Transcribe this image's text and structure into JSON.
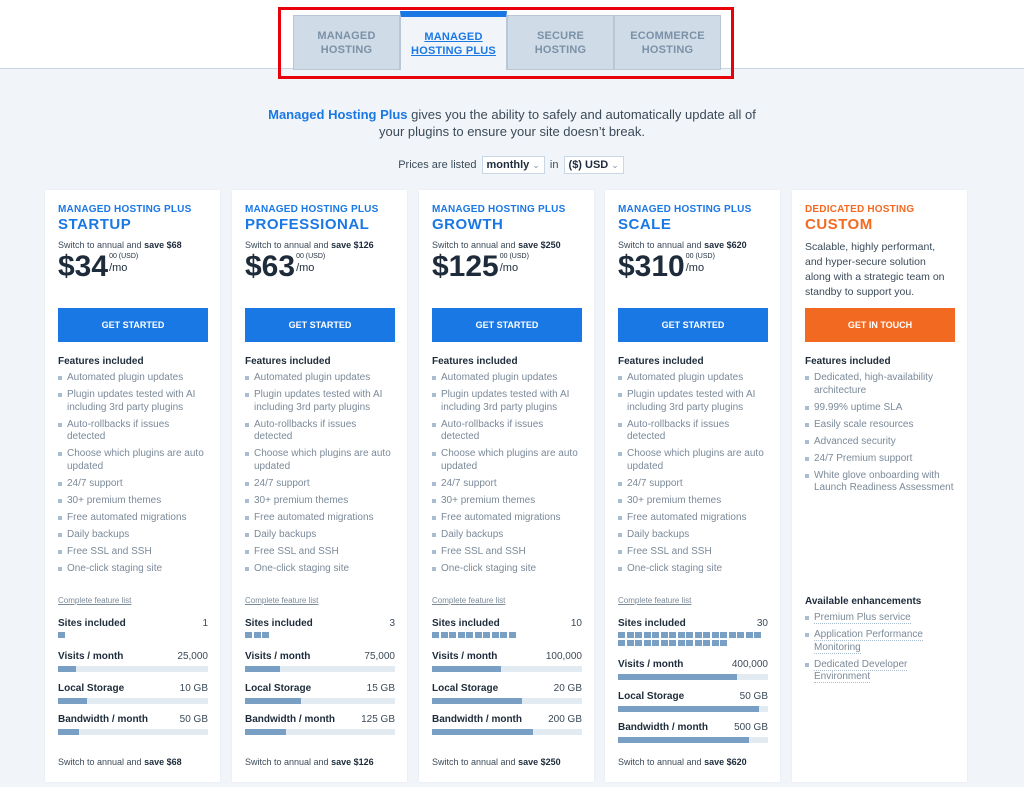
{
  "tabs": [
    {
      "line1": "MANAGED",
      "line2": "HOSTING",
      "active": false
    },
    {
      "line1": "MANAGED",
      "line2": "HOSTING PLUS",
      "active": true
    },
    {
      "line1": "SECURE",
      "line2": "HOSTING",
      "active": false
    },
    {
      "line1": "ECOMMERCE",
      "line2": "HOSTING",
      "active": false
    }
  ],
  "intro": {
    "brand": "Managed Hosting Plus",
    "text": " gives you the ability to safely and automatically update all of",
    "text2": "your plugins to ensure your site doesn’t break."
  },
  "pricing_controls": {
    "prefix": "Prices are listed",
    "period": "monthly",
    "in": "in",
    "currency": "($) USD"
  },
  "colors": {
    "accent": "#1a78e5",
    "orange": "#f26a21",
    "bar_fill": "#7a9fc4"
  },
  "plans": [
    {
      "eyebrow": "MANAGED HOSTING PLUS",
      "name": "STARTUP",
      "switch_text": "Switch to annual and ",
      "save": "save $68",
      "price": "$34",
      "cents": "00 (USD)",
      "per": "/mo",
      "cta": "GET STARTED",
      "features_title": "Features included",
      "features": [
        "Automated plugin updates",
        "Plugin updates tested with AI including 3rd party plugins",
        "Auto-rollbacks if issues detected",
        "Choose which plugins are auto updated",
        "24/7 support",
        "30+ premium themes",
        "Free automated migrations",
        "Daily backups",
        "Free SSL and SSH",
        "One-click staging site"
      ],
      "complete_link": "Complete feature list",
      "sites_label": "Sites included",
      "sites": 1,
      "stats": [
        {
          "label": "Visits / month",
          "value": "25,000",
          "fill": 0.12
        },
        {
          "label": "Local Storage",
          "value": "10 GB",
          "fill": 0.19
        },
        {
          "label": "Bandwidth / month",
          "value": "50 GB",
          "fill": 0.14
        }
      ]
    },
    {
      "eyebrow": "MANAGED HOSTING PLUS",
      "name": "PROFESSIONAL",
      "switch_text": "Switch to annual and ",
      "save": "save $126",
      "price": "$63",
      "cents": "00 (USD)",
      "per": "/mo",
      "cta": "GET STARTED",
      "features_title": "Features included",
      "features": [
        "Automated plugin updates",
        "Plugin updates tested with AI including 3rd party plugins",
        "Auto-rollbacks if issues detected",
        "Choose which plugins are auto updated",
        "24/7 support",
        "30+ premium themes",
        "Free automated migrations",
        "Daily backups",
        "Free SSL and SSH",
        "One-click staging site"
      ],
      "complete_link": "Complete feature list",
      "sites_label": "Sites included",
      "sites": 3,
      "stats": [
        {
          "label": "Visits / month",
          "value": "75,000",
          "fill": 0.23
        },
        {
          "label": "Local Storage",
          "value": "15 GB",
          "fill": 0.37
        },
        {
          "label": "Bandwidth / month",
          "value": "125 GB",
          "fill": 0.27
        }
      ]
    },
    {
      "eyebrow": "MANAGED HOSTING PLUS",
      "name": "GROWTH",
      "switch_text": "Switch to annual and ",
      "save": "save $250",
      "price": "$125",
      "cents": "00 (USD)",
      "per": "/mo",
      "cta": "GET STARTED",
      "features_title": "Features included",
      "features": [
        "Automated plugin updates",
        "Plugin updates tested with AI including 3rd party plugins",
        "Auto-rollbacks if issues detected",
        "Choose which plugins are auto updated",
        "24/7 support",
        "30+ premium themes",
        "Free automated migrations",
        "Daily backups",
        "Free SSL and SSH",
        "One-click staging site"
      ],
      "complete_link": "Complete feature list",
      "sites_label": "Sites included",
      "sites": 10,
      "stats": [
        {
          "label": "Visits / month",
          "value": "100,000",
          "fill": 0.46
        },
        {
          "label": "Local Storage",
          "value": "20 GB",
          "fill": 0.6
        },
        {
          "label": "Bandwidth / month",
          "value": "200 GB",
          "fill": 0.67
        }
      ]
    },
    {
      "eyebrow": "MANAGED HOSTING PLUS",
      "name": "SCALE",
      "switch_text": "Switch to annual and ",
      "save": "save $620",
      "price": "$310",
      "cents": "00 (USD)",
      "per": "/mo",
      "cta": "GET STARTED",
      "features_title": "Features included",
      "features": [
        "Automated plugin updates",
        "Plugin updates tested with AI including 3rd party plugins",
        "Auto-rollbacks if issues detected",
        "Choose which plugins are auto updated",
        "24/7 support",
        "30+ premium themes",
        "Free automated migrations",
        "Daily backups",
        "Free SSL and SSH",
        "One-click staging site"
      ],
      "complete_link": "Complete feature list",
      "sites_label": "Sites included",
      "sites": 30,
      "stats": [
        {
          "label": "Visits / month",
          "value": "400,000",
          "fill": 0.79
        },
        {
          "label": "Local Storage",
          "value": "50 GB",
          "fill": 0.94
        },
        {
          "label": "Bandwidth / month",
          "value": "500 GB",
          "fill": 0.87
        }
      ]
    }
  ],
  "custom": {
    "eyebrow": "DEDICATED HOSTING",
    "name": "CUSTOM",
    "description": "Scalable, highly performant, and hyper-secure solution along with a strategic team on standby to support you.",
    "cta": "GET IN TOUCH",
    "features_title": "Features included",
    "features": [
      "Dedicated, high-availability architecture",
      "99.99% uptime SLA",
      "Easily scale resources",
      "Advanced security",
      "24/7 Premium support",
      "White glove onboarding with Launch Readiness Assessment"
    ],
    "enhancements_title": "Available enhancements",
    "enhancements": [
      "Premium Plus service",
      "Application Performance Monitoring",
      "Dedicated Developer Environment"
    ]
  }
}
